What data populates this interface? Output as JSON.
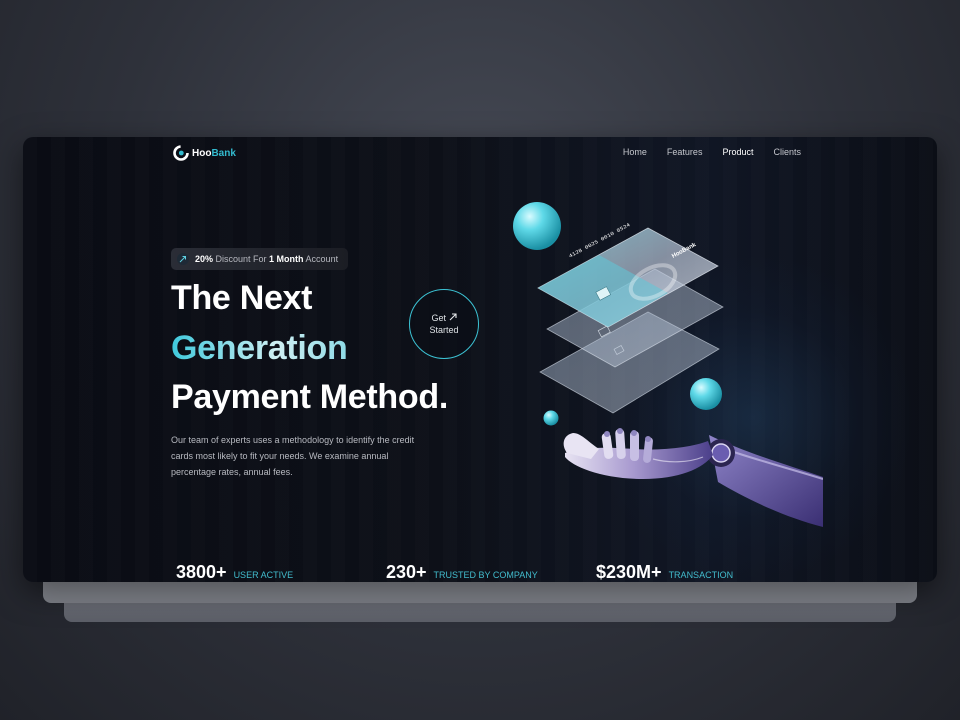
{
  "brand": {
    "name_part1": "Hoo",
    "name_part2": "Bank",
    "accent_color": "#33bbcf"
  },
  "nav": {
    "items": [
      "Home",
      "Features",
      "Product",
      "Clients"
    ],
    "active": "Product"
  },
  "badge": {
    "icon": "rocket-icon",
    "bold1": "20%",
    "text1": " Discount For ",
    "bold2": "1 Month",
    "text2": " Account"
  },
  "hero": {
    "line1": "The Next",
    "line2": "Generation",
    "line3": "Payment Method.",
    "description": "Our team of experts uses a methodology to identify the credit cards most likely to fit your needs. We examine annual percentage rates, annual fees."
  },
  "cta": {
    "line1": "Get",
    "line2": "Started",
    "icon": "arrow-up-right-icon"
  },
  "card": {
    "number": "4128 0025 0010 8524",
    "brand": "HooBank"
  },
  "stats": [
    {
      "value": "3800+",
      "label": "USER ACTIVE"
    },
    {
      "value": "230+",
      "label": "TRUSTED BY COMPANY"
    },
    {
      "value": "$230M+",
      "label": "TRANSACTION"
    }
  ]
}
